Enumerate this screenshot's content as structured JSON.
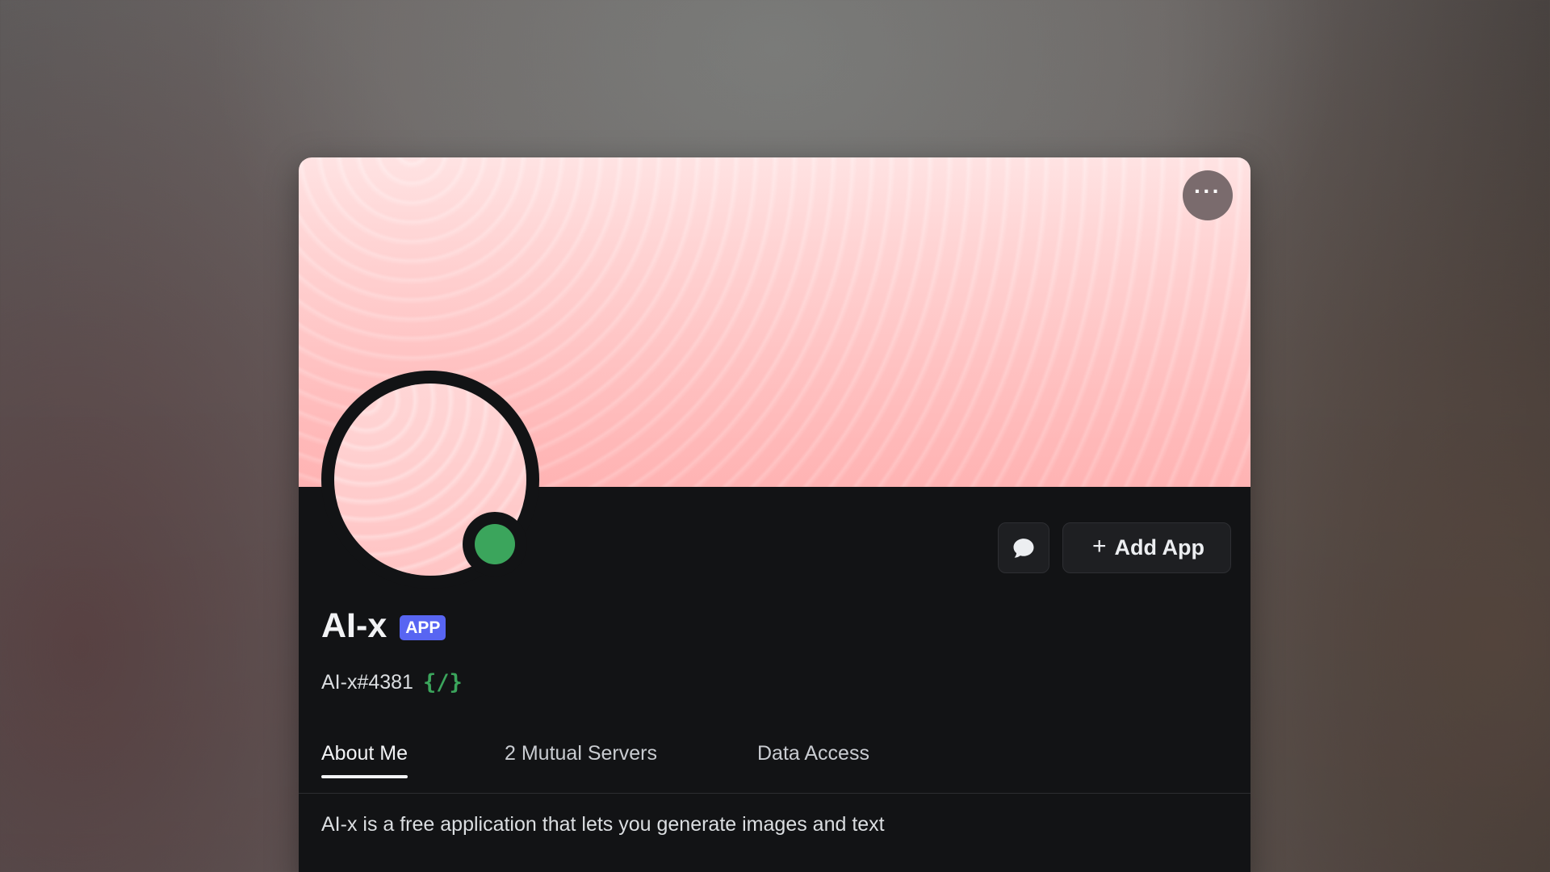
{
  "profile": {
    "display_name": "AI-x",
    "badge": "APP",
    "username_tag": "AI-x#4381",
    "command_icon_text": "{/}",
    "status": "online",
    "status_color": "#3ba55c",
    "banner_color": "#ffc4c4"
  },
  "actions": {
    "more_label": "···",
    "message_icon": "chat-bubble-icon",
    "add_app_plus": "+",
    "add_app_label": "Add App"
  },
  "tabs": [
    {
      "label": "About Me",
      "active": true
    },
    {
      "label": "2 Mutual Servers",
      "active": false
    },
    {
      "label": "Data Access",
      "active": false
    }
  ],
  "about": {
    "text": "AI-x is a free application that lets you generate images and text"
  },
  "colors": {
    "accent_badge": "#5865f2",
    "card_bg": "#121315"
  }
}
